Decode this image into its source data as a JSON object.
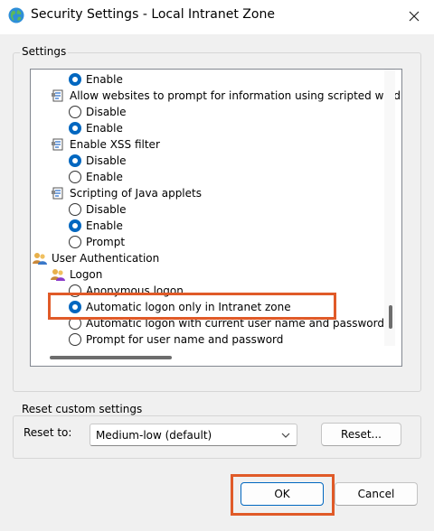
{
  "window": {
    "title": "Security Settings - Local Intranet Zone",
    "app_icon": "globe-icon",
    "close_icon": "close-icon"
  },
  "settings_group": {
    "label": "Settings",
    "tree": [
      {
        "kind": "radio",
        "label": "Enable",
        "checked": true
      },
      {
        "kind": "setting",
        "label": "Allow websites to prompt for information using scripted wind",
        "icon": "setting-icon"
      },
      {
        "kind": "radio",
        "label": "Disable",
        "checked": false
      },
      {
        "kind": "radio",
        "label": "Enable",
        "checked": true
      },
      {
        "kind": "setting",
        "label": "Enable XSS filter",
        "icon": "setting-icon"
      },
      {
        "kind": "radio",
        "label": "Disable",
        "checked": true
      },
      {
        "kind": "radio",
        "label": "Enable",
        "checked": false
      },
      {
        "kind": "setting",
        "label": "Scripting of Java applets",
        "icon": "setting-icon"
      },
      {
        "kind": "radio",
        "label": "Disable",
        "checked": false
      },
      {
        "kind": "radio",
        "label": "Enable",
        "checked": true
      },
      {
        "kind": "radio",
        "label": "Prompt",
        "checked": false
      },
      {
        "kind": "category",
        "label": "User Authentication",
        "icon": "users-icon"
      },
      {
        "kind": "setting",
        "label": "Logon",
        "icon": "users-icon"
      },
      {
        "kind": "radio",
        "label": "Anonymous logon",
        "checked": false
      },
      {
        "kind": "radio",
        "label": "Automatic logon only in Intranet zone",
        "checked": true
      },
      {
        "kind": "radio",
        "label": "Automatic logon with current user name and password",
        "checked": false
      },
      {
        "kind": "radio",
        "label": "Prompt for user name and password",
        "checked": false
      }
    ]
  },
  "reset_group": {
    "label": "Reset custom settings",
    "reset_to_label": "Reset to:",
    "reset_to_value": "Medium-low (default)",
    "reset_button": "Reset..."
  },
  "footer": {
    "ok": "OK",
    "cancel": "Cancel"
  },
  "colors": {
    "accent": "#0067c0",
    "highlight": "#e05a28"
  }
}
